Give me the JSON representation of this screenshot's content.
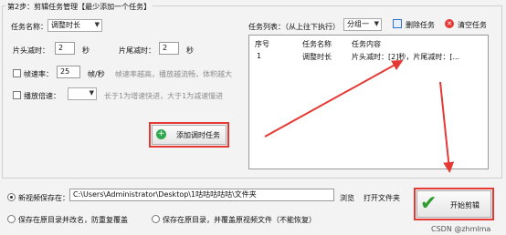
{
  "section": {
    "title": "第2步：剪辑任务管理【最少添加一个任务】"
  },
  "task_name": {
    "label": "任务名称：",
    "value": "调整时长"
  },
  "head_cut": {
    "label": "片头减时：",
    "value": "2",
    "unit": "秒"
  },
  "tail_cut": {
    "label": "片尾减时：",
    "value": "2",
    "unit": "秒"
  },
  "frame_rate": {
    "label": "帧速率：",
    "value": "25",
    "unit": "帧/秒",
    "hint": "帧速率越高，播放越流畅，体积越大"
  },
  "speed": {
    "label": "播放倍速：",
    "value": "",
    "hint": "长于1为增速快进，大于1为减速慢进"
  },
  "add_task_button": {
    "label": "添加调时任务"
  },
  "task_list": {
    "label": "任务列表：（从上往下执行）",
    "group_select": "分组一",
    "delete_label": "删除任务",
    "clear_label": "清空任务",
    "columns": [
      "序号",
      "任务名称",
      "任务内容"
    ],
    "rows": [
      {
        "index": "1",
        "name": "调整时长",
        "content": "片头减时：[2]秒，片尾减时：[..."
      }
    ]
  },
  "output": {
    "new_save_label": "新视频保存在：",
    "path": "C:\\Users\\Administrator\\Desktop\\1咕咕咕咕咕\\文件夹",
    "browse_label": "浏览",
    "open_folder_label": "打开文件夹",
    "option_rename": "保存在原目录并改名，防重复覆盖",
    "option_overwrite": "保存在原目录，并覆盖原视频文件（不能恢复）"
  },
  "start_button": {
    "label": "开始剪辑"
  },
  "watermark": "CSDN @zhmlma",
  "colors": {
    "annotation_red": "#e53935",
    "check_green": "#2e9b2e",
    "add_green": "#2fa84f",
    "delete_blue": "#2f6fd6",
    "clear_red": "#e53935"
  }
}
